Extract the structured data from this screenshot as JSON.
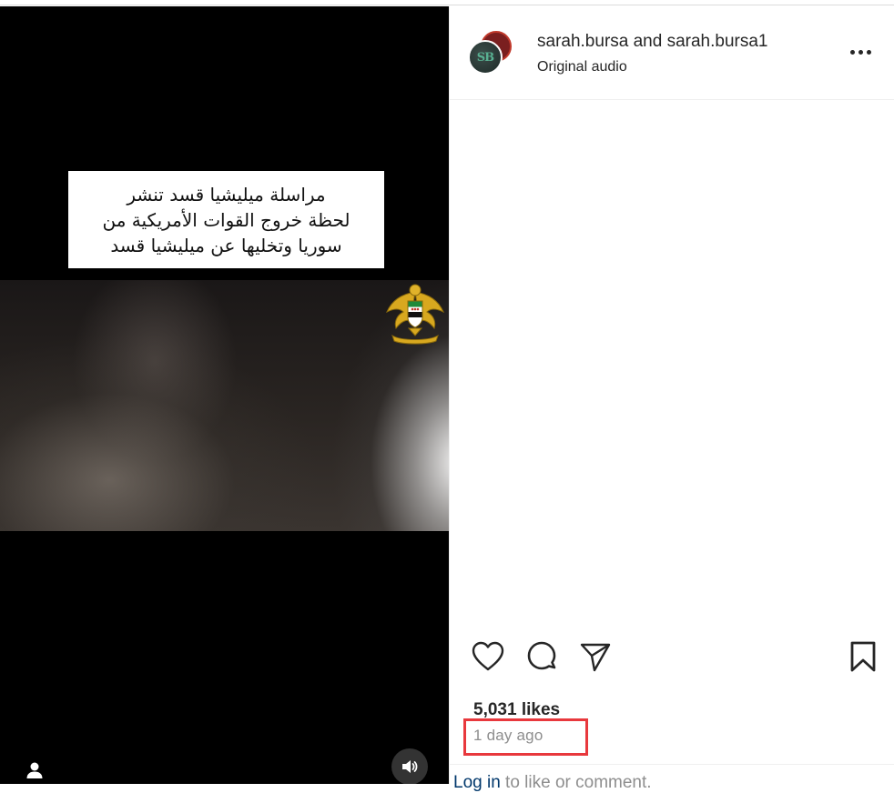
{
  "video": {
    "caption_lines": [
      "مراسلة ميليشيا قسد تنشر",
      "لحظة خروج القوات الأمريكية من",
      "سوريا وتخليها عن ميليشيا قسد"
    ],
    "emblem_icon": "syrian-eagle-emblem-icon",
    "user_icon": "user-icon",
    "audio_icon": "volume-icon"
  },
  "post": {
    "owners_text": "sarah.bursa and sarah.bursa1",
    "avatar_initials": "SB",
    "audio_label": "Original audio",
    "likes_text": "5,031 likes",
    "time_text": "1 day ago",
    "login_link": "Log in",
    "login_rest": " to like or comment."
  },
  "actions": {
    "like_icon": "heart-icon",
    "comment_icon": "comment-icon",
    "share_icon": "share-icon",
    "save_icon": "bookmark-icon"
  },
  "colors": {
    "highlight": "#e8383d",
    "link": "#00376b",
    "muted": "#8e8e8e"
  }
}
